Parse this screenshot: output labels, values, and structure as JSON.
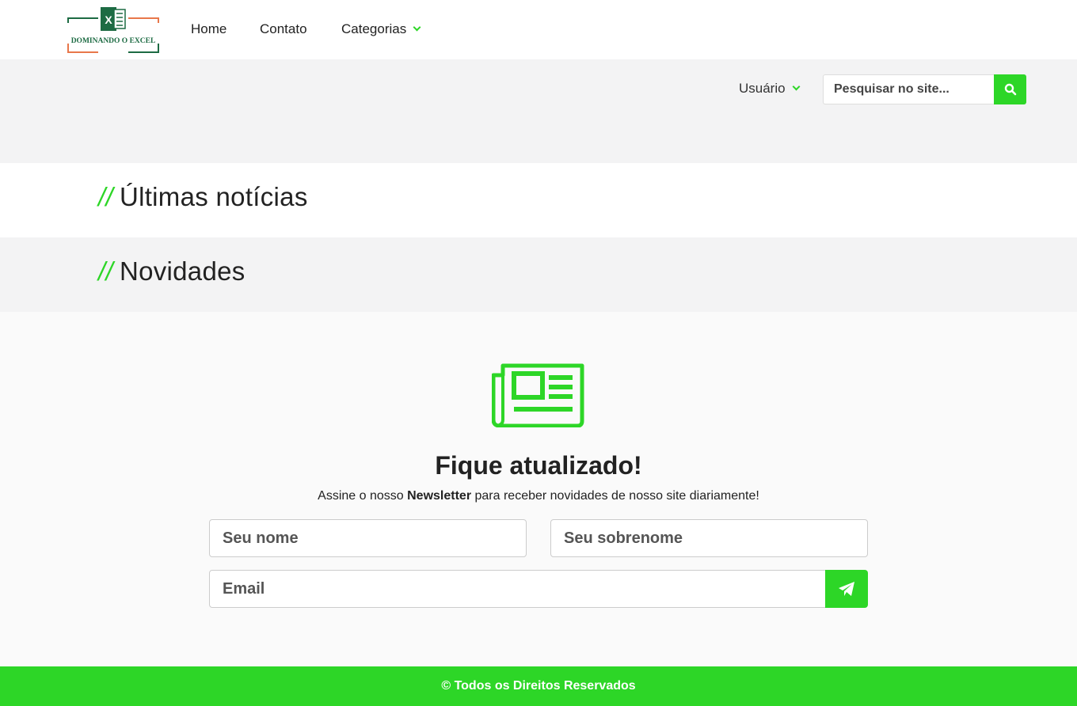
{
  "header": {
    "logo_text": "DOMINANDO O EXCEL",
    "logo_badge": "X",
    "nav": [
      {
        "label": "Home"
      },
      {
        "label": "Contato"
      },
      {
        "label": "Categorias"
      }
    ]
  },
  "toolbar": {
    "user_menu_label": "Usuário",
    "search_placeholder": "Pesquisar no site..."
  },
  "sections": {
    "latest_news_slash": "//",
    "latest_news_title": "Últimas notícias",
    "news_slash": "//",
    "news_title": "Novidades"
  },
  "newsletter": {
    "title": "Fique atualizado!",
    "subtitle_before": "Assine o nosso ",
    "subtitle_bold": "Newsletter",
    "subtitle_after": " para receber novidades de nosso site diariamente!",
    "first_name_placeholder": "Seu nome",
    "last_name_placeholder": "Seu sobrenome",
    "email_placeholder": "Email"
  },
  "footer": {
    "text": "© Todos os Direitos Reservados"
  },
  "colors": {
    "accent": "#2dd627",
    "gray_band": "#f3f3f4",
    "logo_green": "#1d6b43",
    "logo_orange": "#e8774a"
  }
}
